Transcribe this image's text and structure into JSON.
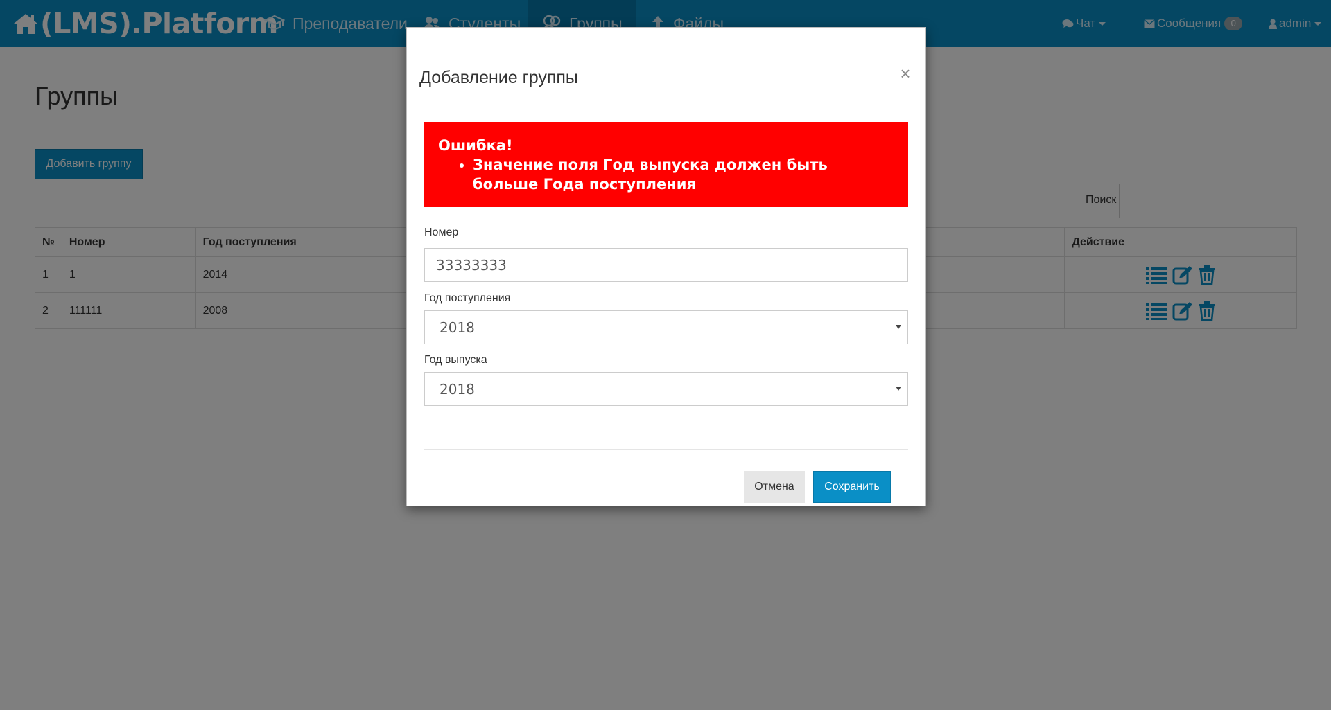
{
  "navbar": {
    "brand": "(LMS).Platform",
    "items": [
      {
        "label": "Преподаватели",
        "icon": "graduation-cap-icon"
      },
      {
        "label": "Студенты",
        "icon": "users-icon"
      },
      {
        "label": "Группы",
        "icon": "group-icon",
        "active": true
      },
      {
        "label": "Файлы",
        "icon": "upload-icon"
      }
    ],
    "chat_label": "Чат",
    "messages_label": "Сообщения",
    "messages_count": "0",
    "user_label": "admin"
  },
  "page": {
    "title": "Группы",
    "add_button": "Добавить группу",
    "search_label": "Поиск",
    "search_value": ""
  },
  "table": {
    "headers": [
      "№",
      "Номер",
      "Год поступления",
      "Действие"
    ],
    "rows": [
      {
        "index": "1",
        "number": "1",
        "year": "2014"
      },
      {
        "index": "2",
        "number": "111111",
        "year": "2008"
      }
    ]
  },
  "modal": {
    "title": "Добавление группы",
    "close": "×",
    "error_title": "Ошибка!",
    "error_items": [
      "Значение поля Год выпуска должен быть больше Года поступления"
    ],
    "fields": {
      "number_label": "Номер",
      "number_value": "33333333",
      "start_year_label": "Год поступления",
      "start_year_value": "2018",
      "end_year_label": "Год выпуска",
      "end_year_value": "2018"
    },
    "cancel_button": "Отмена",
    "save_button": "Сохранить"
  },
  "colors": {
    "navbar": "#0a8fc6",
    "navbar_active": "#0779aa",
    "accent": "#0a8fc6",
    "error": "#ff0000",
    "backdrop": "rgba(0,0,0,0.5)"
  }
}
